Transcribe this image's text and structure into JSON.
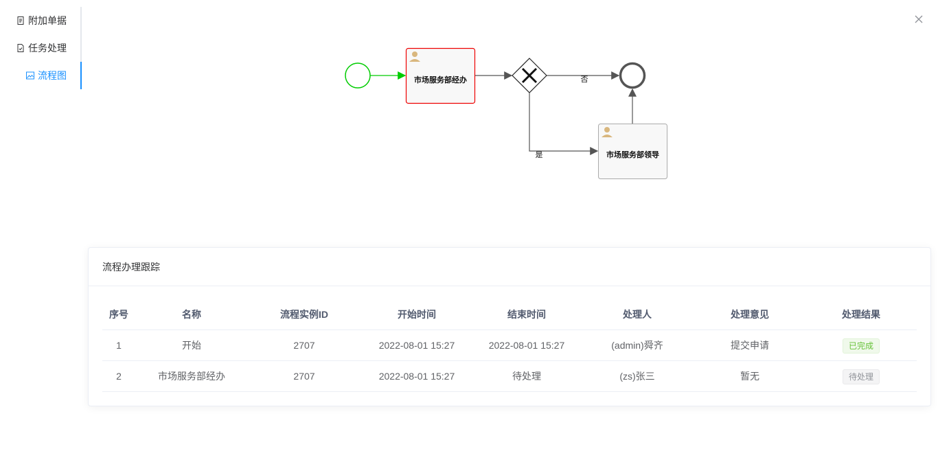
{
  "side_tabs": [
    {
      "label": "附加单据",
      "icon": "document-icon"
    },
    {
      "label": "任务处理",
      "icon": "task-file-icon"
    },
    {
      "label": "流程图",
      "icon": "image-icon",
      "active": true
    }
  ],
  "close_icon": "close-icon",
  "diagram": {
    "task1_label": "市场服务部经办",
    "task2_label": "市场服务部领导",
    "flow_no_label": "否",
    "flow_yes_label": "是",
    "colors": {
      "start": "#00cc00",
      "active_task_border": "#ff0000",
      "end": "#555555"
    }
  },
  "tracking": {
    "title": "流程办理跟踪",
    "columns": [
      "序号",
      "名称",
      "流程实例ID",
      "开始时间",
      "结束时间",
      "处理人",
      "处理意见",
      "处理结果"
    ],
    "rows": [
      {
        "index": "1",
        "name": "开始",
        "instance_id": "2707",
        "start": "2022-08-01 15:27",
        "end": "2022-08-01 15:27",
        "handler": "(admin)舜齐",
        "opinion": "提交申请",
        "result": "已完成",
        "result_type": "success"
      },
      {
        "index": "2",
        "name": "市场服务部经办",
        "instance_id": "2707",
        "start": "2022-08-01 15:27",
        "end": "待处理",
        "handler": "(zs)张三",
        "opinion": "暂无",
        "result": "待处理",
        "result_type": "info"
      }
    ]
  }
}
